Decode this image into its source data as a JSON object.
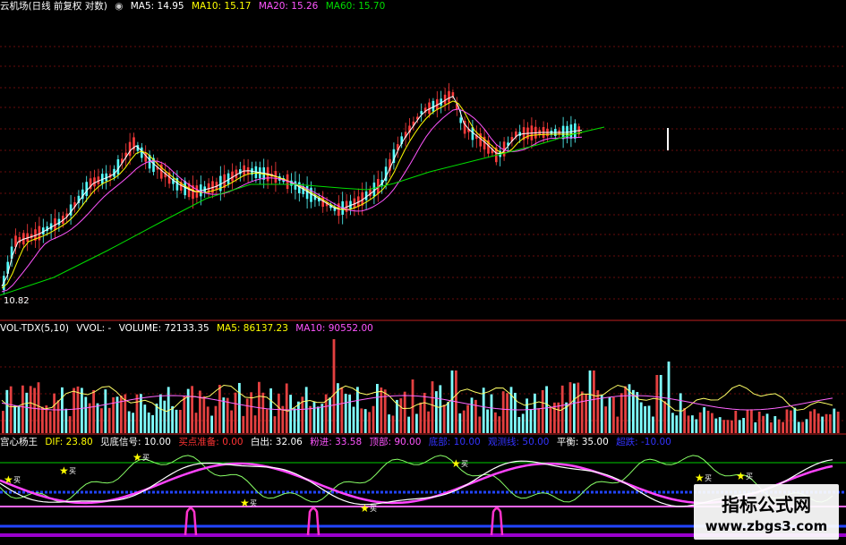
{
  "price_panel": {
    "header": {
      "title": "云机场(日线 前复权 对数)",
      "ma5": "MA5: 14.95",
      "ma10": "MA10: 15.17",
      "ma20": "MA20: 15.26",
      "ma60": "MA60: 15.70"
    },
    "low_label": "10.82"
  },
  "volume_panel": {
    "header": {
      "name": "VOL-TDX(5,10)",
      "vvol": "VVOL: -",
      "volume": "VOLUME: 72133.35",
      "ma5": "MA5: 86137.23",
      "ma10": "MA10: 90552.00"
    }
  },
  "indicator_panel": {
    "header": {
      "name": "宫心杨王",
      "dif": "DIF: 23.80",
      "signal": "见底信号: 10.00",
      "buy_ready": "买点准备: 0.00",
      "exit": "白出: 32.06",
      "fen_jin": "粉进: 33.58",
      "top": "顶部: 90.00",
      "bottom": "底部: 10.00",
      "watch": "观测线: 50.00",
      "balance": "平衡: 35.00",
      "overbought": "超跌: -10.00"
    },
    "marker_text": "买"
  },
  "colors": {
    "background": "#000000",
    "up": "#ff3b3b",
    "down": "#54ffff",
    "ma5": "#ffffff",
    "ma10": "#ffff00",
    "ma20": "#ff55ff",
    "ma60": "#00dd00",
    "grid": "#8a1010"
  },
  "watermark": {
    "title": "指标公式网",
    "url": "www.zbgs3.com"
  }
}
